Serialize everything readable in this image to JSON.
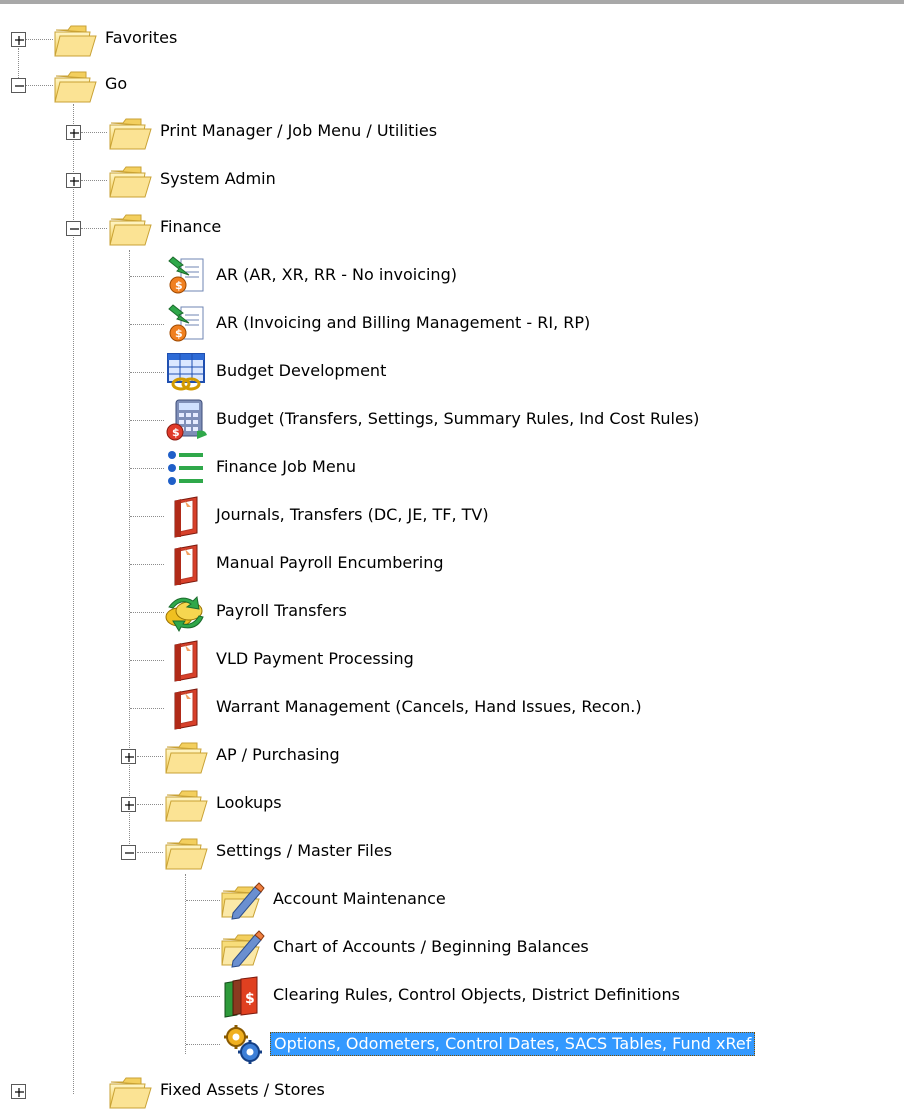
{
  "tree": {
    "favorites": {
      "label": "Favorites",
      "expander": "+"
    },
    "go": {
      "label": "Go",
      "expander": "-"
    },
    "print_manager": {
      "label": "Print Manager / Job Menu / Utilities",
      "expander": "+"
    },
    "system_admin": {
      "label": "System Admin",
      "expander": "+"
    },
    "finance": {
      "label": "Finance",
      "expander": "-",
      "items": [
        {
          "label": "AR (AR, XR, RR - No invoicing)",
          "icon": "ar-invoice-icon"
        },
        {
          "label": "AR (Invoicing and Billing Management - RI, RP)",
          "icon": "ar-invoice-icon"
        },
        {
          "label": "Budget Development",
          "icon": "budget-grid-icon"
        },
        {
          "label": "Budget  (Transfers, Settings, Summary Rules, Ind Cost Rules)",
          "icon": "budget-calculator-icon"
        },
        {
          "label": "Finance Job Menu",
          "icon": "job-list-icon"
        },
        {
          "label": "Journals, Transfers (DC, JE, TF, TV)",
          "icon": "red-book-icon"
        },
        {
          "label": "Manual Payroll Encumbering",
          "icon": "red-book-icon"
        },
        {
          "label": "Payroll Transfers",
          "icon": "payroll-transfer-icon"
        },
        {
          "label": "VLD Payment Processing",
          "icon": "red-book-icon"
        },
        {
          "label": "Warrant Management (Cancels, Hand Issues, Recon.)",
          "icon": "red-book-icon"
        }
      ]
    },
    "ap_purchasing": {
      "label": "AP / Purchasing",
      "expander": "+"
    },
    "lookups": {
      "label": "Lookups",
      "expander": "+"
    },
    "settings": {
      "label": "Settings / Master Files",
      "expander": "-",
      "items": [
        {
          "label": "Account Maintenance",
          "icon": "folder-edit-icon"
        },
        {
          "label": "Chart of Accounts / Beginning Balances",
          "icon": "folder-edit-icon"
        },
        {
          "label": "Clearing Rules, Control Objects, District Definitions",
          "icon": "books-icon"
        },
        {
          "label": "Options, Odometers, Control Dates, SACS Tables, Fund xRef",
          "icon": "gears-icon",
          "selected": true
        }
      ]
    },
    "fixed_assets_partial": {
      "label": "Fixed Assets / Stores",
      "expander": "+"
    }
  },
  "colors": {
    "selection": "#3399ff",
    "selection_text": "#ffffff",
    "tree_line": "#8c8c8c",
    "folder": "#f6d66a"
  }
}
